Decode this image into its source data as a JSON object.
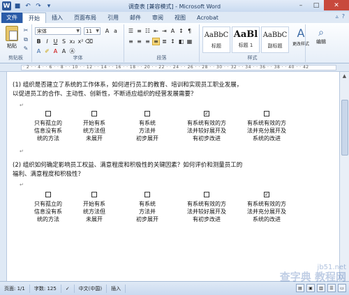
{
  "window": {
    "title": "调查表 [兼容模式] - Microsoft Word"
  },
  "tabs": {
    "file": "文件",
    "items": [
      "开始",
      "插入",
      "页面布局",
      "引用",
      "邮件",
      "审阅",
      "视图",
      "Acrobat"
    ]
  },
  "ribbon": {
    "paste_label": "粘贴",
    "clipboard_label": "剪贴板",
    "font_label": "字体",
    "paragraph_label": "段落",
    "styles_label": "样式",
    "font_name": "宋体",
    "font_size": "11",
    "styles": [
      {
        "sample": "AaBbC",
        "name": "标题"
      },
      {
        "sample": "AaBl",
        "name": "标题 1"
      },
      {
        "sample": "AaBbC",
        "name": "副标题"
      }
    ],
    "change_styles_label": "更改样式",
    "edit_label": "编辑"
  },
  "document": {
    "q1": {
      "text_line1": "(1) 组织是否建立了系统的工作体系，如何进行员工的教育、培训和实现员工职业发展，",
      "text_line2": "以促进员工的合作、主动性、创新性，不断适应组织的经营发展需要？",
      "options": [
        {
          "lines": [
            "只有孤立的",
            "信息没有系",
            "统的方法"
          ],
          "checked": false
        },
        {
          "lines": [
            "开始有系",
            "统方法但",
            "未展开"
          ],
          "checked": false
        },
        {
          "lines": [
            "有系统",
            "方法并",
            "初步展开"
          ],
          "checked": false
        },
        {
          "lines": [
            "有系统有效的方",
            "法并较好展开及",
            "有初步改进"
          ],
          "checked": true
        },
        {
          "lines": [
            "有系统有效的方",
            "法并充分展开及",
            "系统的改进"
          ],
          "checked": false
        }
      ]
    },
    "q2": {
      "text_line1": "(2) 组织如何确定影响员工权益、满意程度和积极性的关键因素？如何评价和测量员工的",
      "text_line2": "福利、满意程度和积极性？",
      "options": [
        {
          "lines": [
            "只有孤立的",
            "信息没有系",
            "统的方法"
          ],
          "checked": false
        },
        {
          "lines": [
            "开始有系",
            "统方法但",
            "未展开"
          ],
          "checked": false
        },
        {
          "lines": [
            "有系统",
            "方法并",
            "初步展开"
          ],
          "checked": false
        },
        {
          "lines": [
            "有系统有效的方",
            "法并较好展开及",
            "有初步改进"
          ],
          "checked": false
        },
        {
          "lines": [
            "有系统有效的方",
            "法并充分展开及",
            "系统的改进"
          ],
          "checked": true
        }
      ]
    }
  },
  "status": {
    "page": "页面: 1/1",
    "words": "字数: 125",
    "language": "中文(中国)",
    "mode": "插入"
  },
  "watermark": {
    "line1": "jb51.net",
    "line2": "查字典 教程网"
  }
}
